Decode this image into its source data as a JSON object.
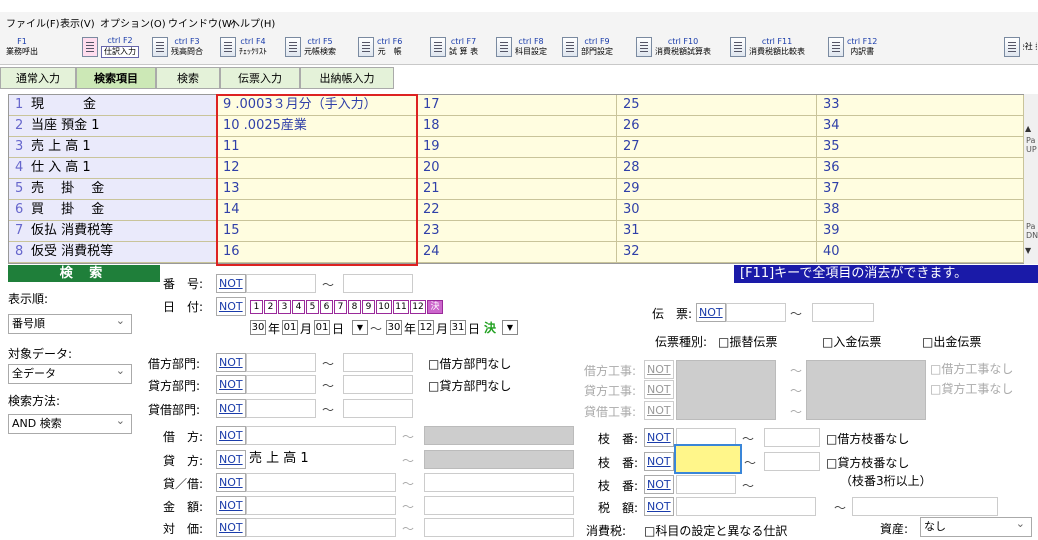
{
  "menu": [
    "ファイル(F)",
    "表示(V)",
    "オプション(O)",
    "ウインドウ(W)",
    "ヘルプ(H)"
  ],
  "toolbar": [
    {
      "key": "F1",
      "label": "業務呼出"
    },
    {
      "key": "ctrl F2",
      "label": "仕訳入力"
    },
    {
      "key": "ctrl F3",
      "label": "残高問合"
    },
    {
      "key": "ctrl F4",
      "label": "ﾁｪｯｸﾘｽﾄ"
    },
    {
      "key": "ctrl F5",
      "label": "元帳検索"
    },
    {
      "key": "ctrl F6",
      "label": "元　帳"
    },
    {
      "key": "ctrl F7",
      "label": "試 算 表"
    },
    {
      "key": "ctrl F8",
      "label": "科目設定"
    },
    {
      "key": "ctrl F9",
      "label": "部門設定"
    },
    {
      "key": "ctrl F10",
      "label": "消費税額試算表"
    },
    {
      "key": "ctrl F11",
      "label": "消費税額比較表"
    },
    {
      "key": "ctrl F12",
      "label": "内訳書"
    }
  ],
  "toolbar_right": "会社 択",
  "tabs": [
    "通常入力",
    "検索項目",
    "検索",
    "伝票入力",
    "出納帳入力"
  ],
  "grid": {
    "col1": [
      {
        "n": "1",
        "t": "現　　　金"
      },
      {
        "n": "2",
        "t": "当座 預金 1"
      },
      {
        "n": "3",
        "t": "売 上 高 1"
      },
      {
        "n": "4",
        "t": "仕 入 高 1"
      },
      {
        "n": "5",
        "t": "売　 掛 　金"
      },
      {
        "n": "6",
        "t": "買 　掛 　金"
      },
      {
        "n": "7",
        "t": "仮払 消費税等"
      },
      {
        "n": "8",
        "t": "仮受 消費税等"
      }
    ],
    "col2": [
      "9 .0003３月分（手入力）",
      "10 .0025産業",
      "11",
      "12",
      "13",
      "14",
      "15",
      "16"
    ],
    "col3": [
      "17",
      "18",
      "19",
      "20",
      "21",
      "22",
      "23",
      "24"
    ],
    "col4": [
      "25",
      "26",
      "27",
      "28",
      "29",
      "30",
      "31",
      "32"
    ],
    "col5": [
      "33",
      "34",
      "35",
      "36",
      "37",
      "38",
      "39",
      "40"
    ]
  },
  "scroll_labels": [
    "Pa UP",
    "Pa DN"
  ],
  "search_title": "検 索",
  "f11_message": "[F11]キーで全項目の消去ができます。",
  "left": {
    "order_label": "表示順:",
    "order_value": "番号順",
    "target_label": "対象データ:",
    "target_value": "全データ",
    "method_label": "検索方法:",
    "method_value": "AND 検索"
  },
  "not": "NOT",
  "tilde": "～",
  "fields": {
    "bango": "番　号:",
    "hizuke": "日　付:",
    "months": [
      "1",
      "2",
      "3",
      "4",
      "5",
      "6",
      "7",
      "8",
      "9",
      "10",
      "11",
      "12",
      "決"
    ],
    "date_from": {
      "y": "30",
      "ylabel": "年",
      "m": "01",
      "mlabel": "月",
      "d": "01",
      "dlabel": "日"
    },
    "date_to": {
      "y": "30",
      "ylabel": "年",
      "m": "12",
      "mlabel": "月",
      "d": "31",
      "dlabel": "日",
      "kessan": "決"
    },
    "karikata_bumon": "借方部門:",
    "kashikata_bumon": "貸方部門:",
    "taishaku_bumon": "貸借部門:",
    "nashi_kari_bumon": "□借方部門なし",
    "nashi_kashi_bumon": "□貸方部門なし",
    "denpyo": "伝　票:",
    "denpyo_type_label": "伝票種別:",
    "denpyo_types": [
      "□振替伝票",
      "□入金伝票",
      "□出金伝票"
    ],
    "kari_koji": "借方工事:",
    "kashi_koji": "貸方工事:",
    "taishaku_koji": "貸借工事:",
    "nashi_kari_koji": "□借方工事なし",
    "nashi_kashi_koji": "□貸方工事なし",
    "karikata": "借　方:",
    "kashikata": "貸　方:",
    "kashikata_value": "売 上 高 1",
    "taishaku": "貸／借:",
    "kingaku": "金　額:",
    "taika": "対　価:",
    "edaban": "枝　番:",
    "nashi_kari_eda": "□借方枝番なし",
    "nashi_kashi_eda": "□貸方枝番なし",
    "eda_note": "（枝番3桁以上）",
    "zeigaku": "税　額:",
    "shohizei": "消費税:",
    "shohizei_chk": "□科目の設定と異なる仕訳",
    "shisan": "資産:",
    "shisan_value": "なし"
  }
}
